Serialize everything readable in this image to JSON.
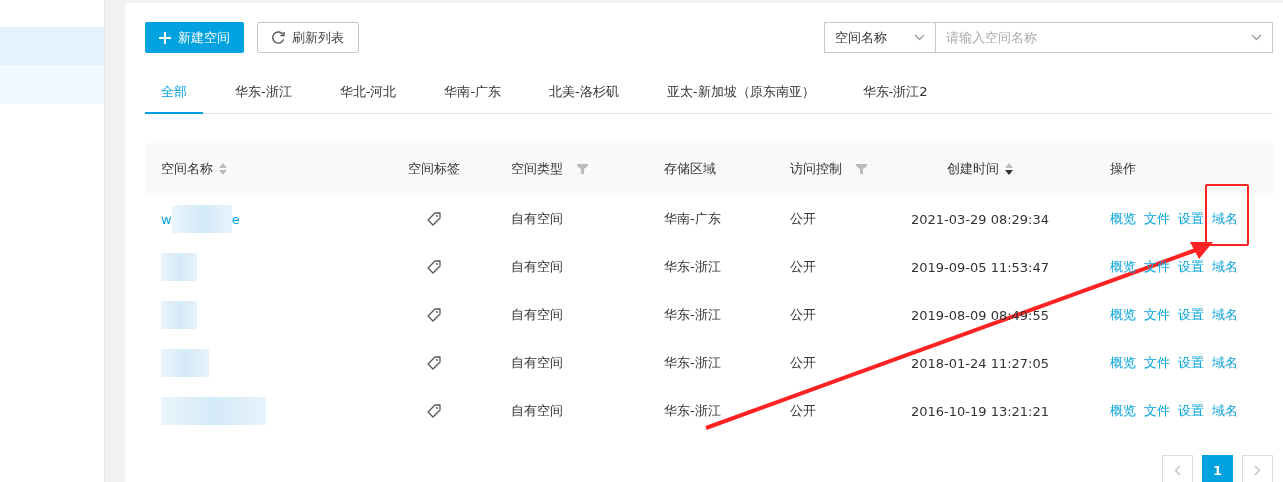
{
  "toolbar": {
    "create_button": "新建空间",
    "refresh_button": "刷新列表",
    "search_select": "空间名称",
    "search_placeholder": "请输入空间名称"
  },
  "tabs": [
    {
      "label": "全部",
      "selected": true
    },
    {
      "label": "华东-浙江",
      "selected": false
    },
    {
      "label": "华北-河北",
      "selected": false
    },
    {
      "label": "华南-广东",
      "selected": false
    },
    {
      "label": "北美-洛杉矶",
      "selected": false
    },
    {
      "label": "亚太-新加坡（原东南亚）",
      "selected": false
    },
    {
      "label": "华东-浙江2",
      "selected": false
    }
  ],
  "table": {
    "columns": [
      {
        "label": "空间名称",
        "kind": "sort"
      },
      {
        "label": "空间标签",
        "kind": "plain"
      },
      {
        "label": "空间类型",
        "kind": "filter"
      },
      {
        "label": "存储区域",
        "kind": "plain"
      },
      {
        "label": "访问控制",
        "kind": "filter"
      },
      {
        "label": "创建时间",
        "kind": "sorted"
      },
      {
        "label": "操作",
        "kind": "plain"
      }
    ],
    "rows": [
      {
        "name_parts": [
          "w",
          "e"
        ],
        "type": "自有空间",
        "region": "华南-广东",
        "access": "公开",
        "created": "2021-03-29 08:29:34",
        "actions": [
          "概览",
          "文件",
          "设置",
          "域名"
        ],
        "last_action_highlighted": true
      },
      {
        "type": "自有空间",
        "region": "华东-浙江",
        "access": "公开",
        "created": "2019-09-05 11:53:47",
        "actions": [
          "概览",
          "文件",
          "设置",
          "域名"
        ],
        "last_action_highlighted": false
      },
      {
        "type": "自有空间",
        "region": "华东-浙江",
        "access": "公开",
        "created": "2019-08-09 08:49:55",
        "actions": [
          "概览",
          "文件",
          "设置",
          "域名"
        ],
        "last_action_highlighted": false
      },
      {
        "type": "自有空间",
        "region": "华东-浙江",
        "access": "公开",
        "created": "2018-01-24 11:27:05",
        "actions": [
          "概览",
          "文件",
          "设置",
          "域名"
        ],
        "last_action_highlighted": false
      },
      {
        "type": "自有空间",
        "region": "华东-浙江",
        "access": "公开",
        "created": "2016-10-19 13:21:21",
        "actions": [
          "概览",
          "文件",
          "设置",
          "域名"
        ],
        "last_action_highlighted": false
      }
    ]
  },
  "pagination": {
    "pages": [
      {
        "label": "1",
        "selected": true
      }
    ]
  }
}
